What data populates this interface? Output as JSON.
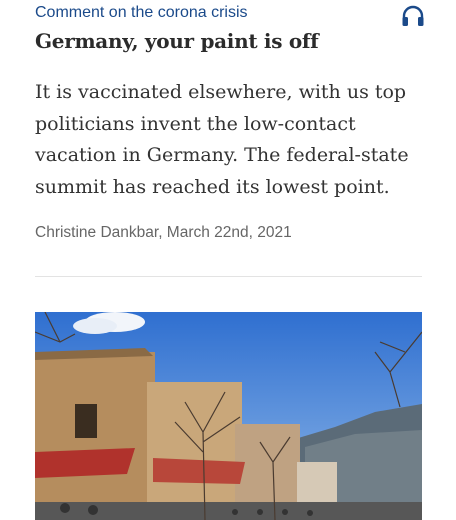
{
  "article": {
    "kicker": "Comment on the corona crisis",
    "headline": "Germany, your paint is off",
    "lead": "It is vaccinated elsewhere, with us top politicians invent the low-contact vacation in Germany. The federal-state summit has reached its lowest point.",
    "byline": "Christine Dankbar, March 22nd, 2021"
  },
  "icons": {
    "audio": "headphones-icon"
  },
  "colors": {
    "kicker": "#1b4a8a",
    "headline": "#2b2b2b",
    "body_text": "#333333",
    "byline": "#666666",
    "divider": "#e3e3e3"
  }
}
